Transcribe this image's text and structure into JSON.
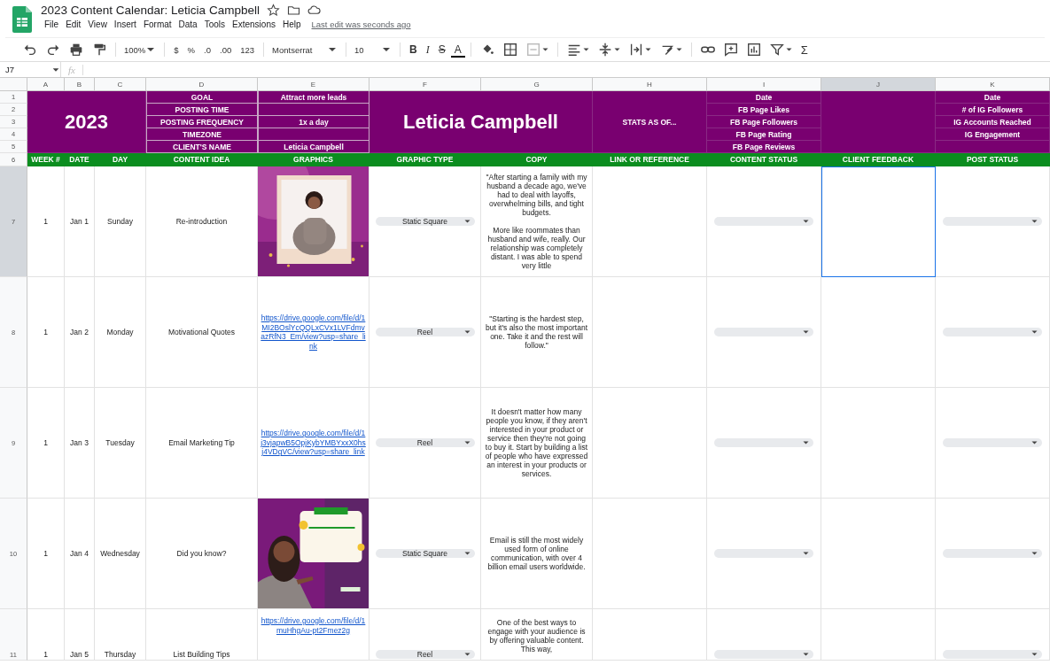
{
  "doc": {
    "title": "2023 Content Calendar: Leticia Campbell",
    "last_edit": "Last edit was seconds ago"
  },
  "menu": [
    "File",
    "Edit",
    "View",
    "Insert",
    "Format",
    "Data",
    "Tools",
    "Extensions",
    "Help"
  ],
  "toolbar": {
    "zoom": "100%",
    "number_formats": [
      "$",
      "%",
      ".0",
      ".00",
      "123"
    ],
    "font": "Montserrat",
    "font_size": "10",
    "text_styles": [
      {
        "kind": "bold",
        "label": "B"
      },
      {
        "kind": "italic",
        "label": "I"
      },
      {
        "kind": "strike",
        "label": "S"
      },
      {
        "kind": "color",
        "label": "A"
      }
    ],
    "functions": "Σ"
  },
  "formula_bar": {
    "name_box": "J7",
    "fx": "fx"
  },
  "columns": [
    {
      "label": "A",
      "selected": false
    },
    {
      "label": "B",
      "selected": false
    },
    {
      "label": "C",
      "selected": false
    },
    {
      "label": "D",
      "selected": false
    },
    {
      "label": "E",
      "selected": false
    },
    {
      "label": "F",
      "selected": false
    },
    {
      "label": "G",
      "selected": false
    },
    {
      "label": "H",
      "selected": false
    },
    {
      "label": "I",
      "selected": false
    },
    {
      "label": "J",
      "selected": true
    },
    {
      "label": "K",
      "selected": false
    }
  ],
  "summary": {
    "row_numbers": [
      "1",
      "2",
      "3",
      "4",
      "5",
      "6"
    ],
    "year": "2023",
    "fields": [
      {
        "label": "GOAL",
        "value": "Attract more leads"
      },
      {
        "label": "POSTING TIME"
      },
      {
        "label": "POSTING FREQUENCY",
        "value": "1x a day"
      },
      {
        "label": "TIMEZONE"
      },
      {
        "label": "CLIENT'S NAME",
        "value": "Leticia Campbell"
      }
    ],
    "client": "Leticia Campbell",
    "stats_label": "STATS AS OF...",
    "fb_stats": [
      "Date",
      "FB Page Likes",
      "FB Page Followers",
      "FB Page Rating",
      "FB Page Reviews"
    ],
    "ig_stats": [
      "Date",
      "# of IG Followers",
      "IG Accounts Reached",
      "IG Engagement"
    ]
  },
  "header_row": [
    "WEEK #",
    "DATE",
    "DAY",
    "CONTENT IDEA",
    "GRAPHICS",
    "GRAPHIC TYPE",
    "COPY",
    "LINK OR REFERENCE",
    "CONTENT STATUS",
    "CLIENT FEEDBACK",
    "POST STATUS"
  ],
  "rows": [
    {
      "num": "7",
      "selected": true,
      "week": "1",
      "date": "Jan 1",
      "day": "Sunday",
      "idea": "Re-introduction",
      "graphic_type": "Static Square",
      "copy": "\"After starting a family with my husband a decade ago, we've had to deal with layoffs, overwhelming bills, and tight budgets.\n\nMore like roommates than husband and wife, really. Our relationship was completely distant. I was able to spend very little"
    },
    {
      "num": "8",
      "selected": false,
      "week": "1",
      "date": "Jan 2",
      "day": "Monday",
      "idea": "Motivational Quotes",
      "graphic": {
        "kind": "link",
        "text": "https://drive.google.com/file/d/1MI2BOslYcQQLxCVx1LVFdmvazRfN3_Em/view?usp=share_link"
      },
      "graphic_type": "Reel",
      "copy": "\"Starting is the hardest step, but it's also the most important one. Take it and the rest will follow.\""
    },
    {
      "num": "9",
      "selected": false,
      "week": "1",
      "date": "Jan 3",
      "day": "Tuesday",
      "idea": "Email Marketing Tip",
      "graphic": {
        "kind": "link",
        "text": "https://drive.google.com/file/d/1j3vjapwB5OpjKybYMBYxxX0hsj4VDgVC/view?usp=share_link"
      },
      "graphic_type": "Reel",
      "copy": "It doesn't matter how many people you know, if they aren't interested in your product or service then they're not going to buy it. Start by building a list of people who have expressed an interest in your products or services."
    },
    {
      "num": "10",
      "selected": false,
      "week": "1",
      "date": "Jan 4",
      "day": "Wednesday",
      "idea": "Did you know?",
      "graphic_type": "Static Square",
      "copy": "Email is still the most widely used form of online communication, with over 4 billion email users worldwide."
    },
    {
      "num": "11",
      "selected": false,
      "week": "1",
      "date": "Jan 5",
      "day": "Thursday",
      "idea": "List Building Tips",
      "graphic": {
        "kind": "link",
        "text": "https://drive.google.com/file/d/1muHhgAu-pt2Fmez2g"
      },
      "graphic_type": "Reel",
      "copy": "One of the best ways to engage with your audience is by offering valuable content. This way,"
    }
  ]
}
